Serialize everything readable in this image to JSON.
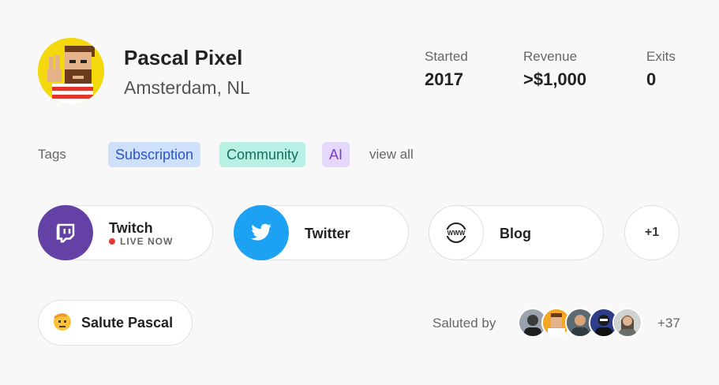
{
  "profile": {
    "name": "Pascal Pixel",
    "location": "Amsterdam, NL"
  },
  "stats": {
    "started": {
      "label": "Started",
      "value": "2017"
    },
    "revenue": {
      "label": "Revenue",
      "value": ">$1,000"
    },
    "exits": {
      "label": "Exits",
      "value": "0"
    }
  },
  "tags": {
    "label": "Tags",
    "items": [
      "Subscription",
      "Community",
      "AI"
    ],
    "view_all": "view all"
  },
  "links": {
    "twitch": {
      "label": "Twitch",
      "status": "LIVE NOW",
      "icon": "twitch-icon",
      "color": "#6441a5"
    },
    "twitter": {
      "label": "Twitter",
      "icon": "twitter-icon",
      "color": "#1da1f2"
    },
    "blog": {
      "label": "Blog",
      "icon": "www-globe-icon"
    },
    "more": "+1"
  },
  "salute": {
    "button_label": "Salute Pascal",
    "icon": "salute-emoji-icon",
    "saluted_by_label": "Saluted by",
    "extra_count": "+37"
  },
  "colors": {
    "tag_subscription_bg": "#cfe0fb",
    "tag_community_bg": "#b9f0e4",
    "tag_ai_bg": "#e6d8fb",
    "live_dot": "#e53935"
  }
}
